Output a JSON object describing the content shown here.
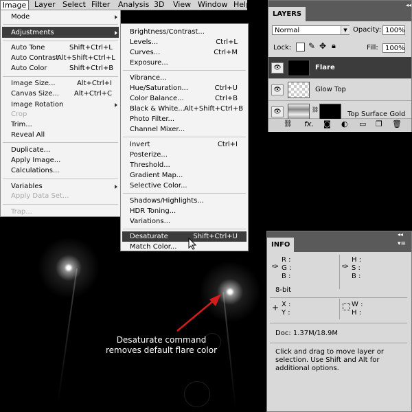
{
  "menubar": {
    "items": [
      "Image",
      "Layer",
      "Select",
      "Filter",
      "Analysis",
      "3D",
      "View",
      "Window",
      "Help"
    ],
    "active": "Image"
  },
  "image_menu": {
    "items": [
      {
        "label": "Mode",
        "shortcut": "",
        "submenu": true,
        "disabled": false
      },
      {
        "label": "Adjustments",
        "shortcut": "",
        "submenu": true,
        "disabled": false,
        "highlighted": true
      },
      {
        "label": "Auto Tone",
        "shortcut": "Shift+Ctrl+L",
        "disabled": false
      },
      {
        "label": "Auto Contrast",
        "shortcut": "Alt+Shift+Ctrl+L",
        "disabled": false
      },
      {
        "label": "Auto Color",
        "shortcut": "Shift+Ctrl+B",
        "disabled": false
      },
      {
        "label": "Image Size...",
        "shortcut": "Alt+Ctrl+I",
        "disabled": false
      },
      {
        "label": "Canvas Size...",
        "shortcut": "Alt+Ctrl+C",
        "disabled": false
      },
      {
        "label": "Image Rotation",
        "shortcut": "",
        "submenu": true,
        "disabled": false
      },
      {
        "label": "Crop",
        "shortcut": "",
        "disabled": true
      },
      {
        "label": "Trim...",
        "shortcut": "",
        "disabled": false
      },
      {
        "label": "Reveal All",
        "shortcut": "",
        "disabled": false
      },
      {
        "label": "Duplicate...",
        "shortcut": "",
        "disabled": false
      },
      {
        "label": "Apply Image...",
        "shortcut": "",
        "disabled": false
      },
      {
        "label": "Calculations...",
        "shortcut": "",
        "disabled": false
      },
      {
        "label": "Variables",
        "shortcut": "",
        "submenu": true,
        "disabled": false
      },
      {
        "label": "Apply Data Set...",
        "shortcut": "",
        "disabled": true
      },
      {
        "label": "Trap...",
        "shortcut": "",
        "disabled": true
      }
    ]
  },
  "adjustments_menu": {
    "items": [
      {
        "label": "Brightness/Contrast...",
        "shortcut": ""
      },
      {
        "label": "Levels...",
        "shortcut": "Ctrl+L"
      },
      {
        "label": "Curves...",
        "shortcut": "Ctrl+M"
      },
      {
        "label": "Exposure...",
        "shortcut": ""
      },
      {
        "label": "Vibrance...",
        "shortcut": ""
      },
      {
        "label": "Hue/Saturation...",
        "shortcut": "Ctrl+U"
      },
      {
        "label": "Color Balance...",
        "shortcut": "Ctrl+B"
      },
      {
        "label": "Black & White...",
        "shortcut": "Alt+Shift+Ctrl+B"
      },
      {
        "label": "Photo Filter...",
        "shortcut": ""
      },
      {
        "label": "Channel Mixer...",
        "shortcut": ""
      },
      {
        "label": "Invert",
        "shortcut": "Ctrl+I"
      },
      {
        "label": "Posterize...",
        "shortcut": ""
      },
      {
        "label": "Threshold...",
        "shortcut": ""
      },
      {
        "label": "Gradient Map...",
        "shortcut": ""
      },
      {
        "label": "Selective Color...",
        "shortcut": ""
      },
      {
        "label": "Shadows/Highlights...",
        "shortcut": ""
      },
      {
        "label": "HDR Toning...",
        "shortcut": ""
      },
      {
        "label": "Variations...",
        "shortcut": ""
      },
      {
        "label": "Desaturate",
        "shortcut": "Shift+Ctrl+U",
        "highlighted": true
      },
      {
        "label": "Match Color...",
        "shortcut": ""
      }
    ]
  },
  "layers_panel": {
    "title": "LAYERS",
    "blend_mode": "Normal",
    "opacity_label": "Opacity:",
    "opacity_value": "100%",
    "lock_label": "Lock:",
    "fill_label": "Fill:",
    "fill_value": "100%",
    "layers": [
      {
        "name": "Flare",
        "selected": true
      },
      {
        "name": "Glow Top",
        "selected": false
      },
      {
        "name": "Top Surface Gold",
        "selected": false
      }
    ]
  },
  "info_panel": {
    "title": "INFO",
    "rgb": [
      "R :",
      "G :",
      "B :"
    ],
    "hsb": [
      "H :",
      "S :",
      "B :"
    ],
    "bit_depth": "8-bit",
    "xy": [
      "X :",
      "Y :"
    ],
    "wh": [
      "W :",
      "H :"
    ],
    "doc": "Doc: 1.37M/18.9M",
    "hint": "Click and drag to move layer or selection.  Use Shift and Alt for additional options."
  },
  "annotation": {
    "text_line1": "Desaturate command",
    "text_line2": "removes default flare color"
  },
  "colors": {
    "menu_highlight": "#3c3c3c",
    "arrow": "#d51c1c",
    "panel": "#d9d9d9"
  }
}
